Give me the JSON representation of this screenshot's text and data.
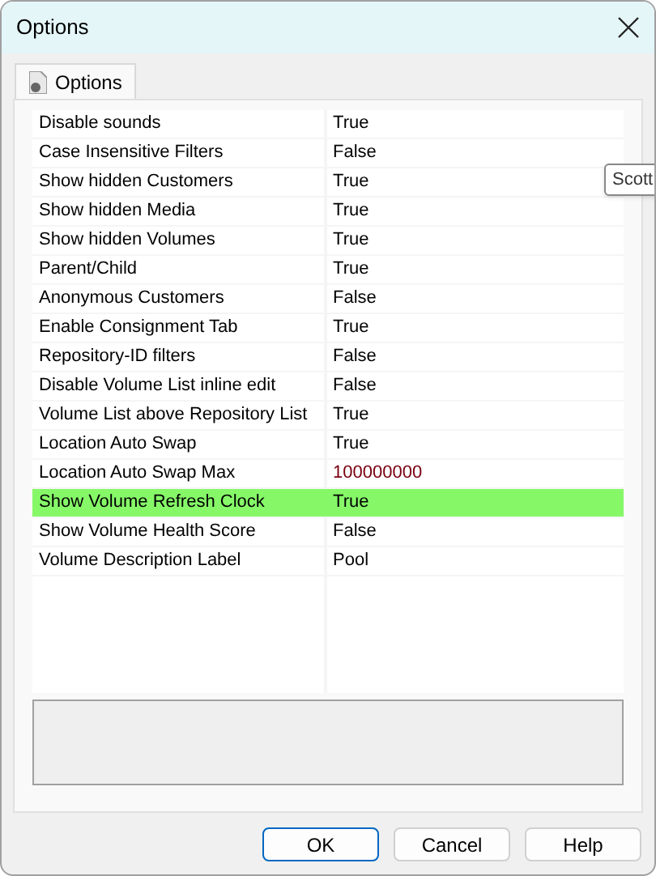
{
  "window": {
    "title": "Options"
  },
  "tabs": [
    {
      "label": "Options",
      "selected": true
    }
  ],
  "properties": [
    {
      "name": "Disable sounds",
      "value": "True",
      "selected": false,
      "modified": false
    },
    {
      "name": "Case Insensitive Filters",
      "value": "False",
      "selected": false,
      "modified": false
    },
    {
      "name": "Show hidden Customers",
      "value": "True",
      "selected": false,
      "modified": false
    },
    {
      "name": "Show hidden Media",
      "value": "True",
      "selected": false,
      "modified": false
    },
    {
      "name": "Show hidden Volumes",
      "value": "True",
      "selected": false,
      "modified": false
    },
    {
      "name": "Parent/Child",
      "value": "True",
      "selected": false,
      "modified": false
    },
    {
      "name": "Anonymous Customers",
      "value": "False",
      "selected": false,
      "modified": false
    },
    {
      "name": "Enable Consignment Tab",
      "value": "True",
      "selected": false,
      "modified": false
    },
    {
      "name": "Repository-ID filters",
      "value": "False",
      "selected": false,
      "modified": false
    },
    {
      "name": "Disable Volume List inline edit",
      "value": "False",
      "selected": false,
      "modified": false
    },
    {
      "name": "Volume List above Repository List",
      "value": "True",
      "selected": false,
      "modified": false
    },
    {
      "name": "Location Auto Swap",
      "value": "True",
      "selected": false,
      "modified": false
    },
    {
      "name": "Location Auto Swap Max",
      "value": "100000000",
      "selected": false,
      "modified": true
    },
    {
      "name": "Show Volume Refresh Clock",
      "value": "True",
      "selected": true,
      "modified": false
    },
    {
      "name": "Show Volume Health Score",
      "value": "False",
      "selected": false,
      "modified": false
    },
    {
      "name": "Volume Description Label",
      "value": "Pool",
      "selected": false,
      "modified": false
    }
  ],
  "tooltip": "Scott",
  "buttons": [
    {
      "label": "OK",
      "default": true
    },
    {
      "label": "Cancel",
      "default": false
    },
    {
      "label": "Help",
      "default": false
    }
  ]
}
